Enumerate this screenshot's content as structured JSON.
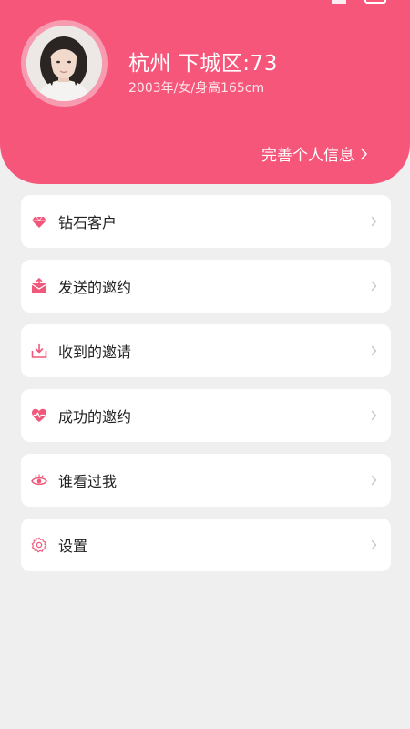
{
  "colors": {
    "accent": "#f5567a",
    "page_background": "#efefef",
    "card_background": "#ffffff",
    "icon_pink": "#f0577b"
  },
  "profile": {
    "name": "杭州 下城区:73",
    "meta": "2003年/女/身高165cm",
    "complete_link": "完善个人信息"
  },
  "menu": {
    "items": [
      {
        "label": "钻石客户",
        "icon": "diamond-icon"
      },
      {
        "label": "发送的邀约",
        "icon": "send-mail-icon"
      },
      {
        "label": "收到的邀请",
        "icon": "inbox-download-icon"
      },
      {
        "label": "成功的邀约",
        "icon": "heartbeat-icon"
      },
      {
        "label": "谁看过我",
        "icon": "eye-icon"
      },
      {
        "label": "设置",
        "icon": "gear-icon"
      }
    ]
  }
}
